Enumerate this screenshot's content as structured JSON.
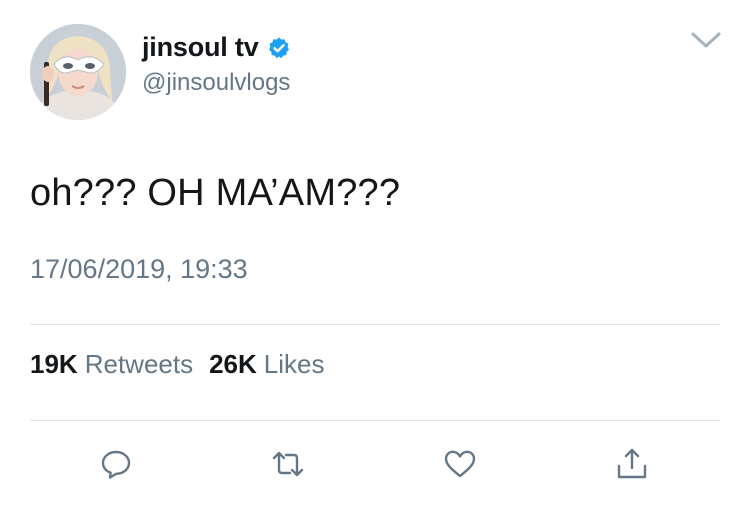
{
  "user": {
    "display_name": "jinsoul tv",
    "handle": "@jinsoulvlogs",
    "verified": true,
    "verified_icon": "verified-badge-icon",
    "avatar": "profile-avatar"
  },
  "tweet": {
    "text": "oh??? OH MA’AM???",
    "timestamp": "17/06/2019, 19:33"
  },
  "stats": {
    "retweets_count": "19K",
    "retweets_label": "Retweets",
    "likes_count": "26K",
    "likes_label": "Likes"
  },
  "actions": {
    "reply_icon": "reply-icon",
    "retweet_icon": "retweet-icon",
    "like_icon": "heart-icon",
    "share_icon": "share-icon",
    "menu_icon": "chevron-down-icon"
  },
  "colors": {
    "text_primary": "#14171a",
    "text_secondary": "#657786",
    "verified_blue": "#1da1f2",
    "divider": "#dfe3e7",
    "icon_gray": "#657786"
  }
}
